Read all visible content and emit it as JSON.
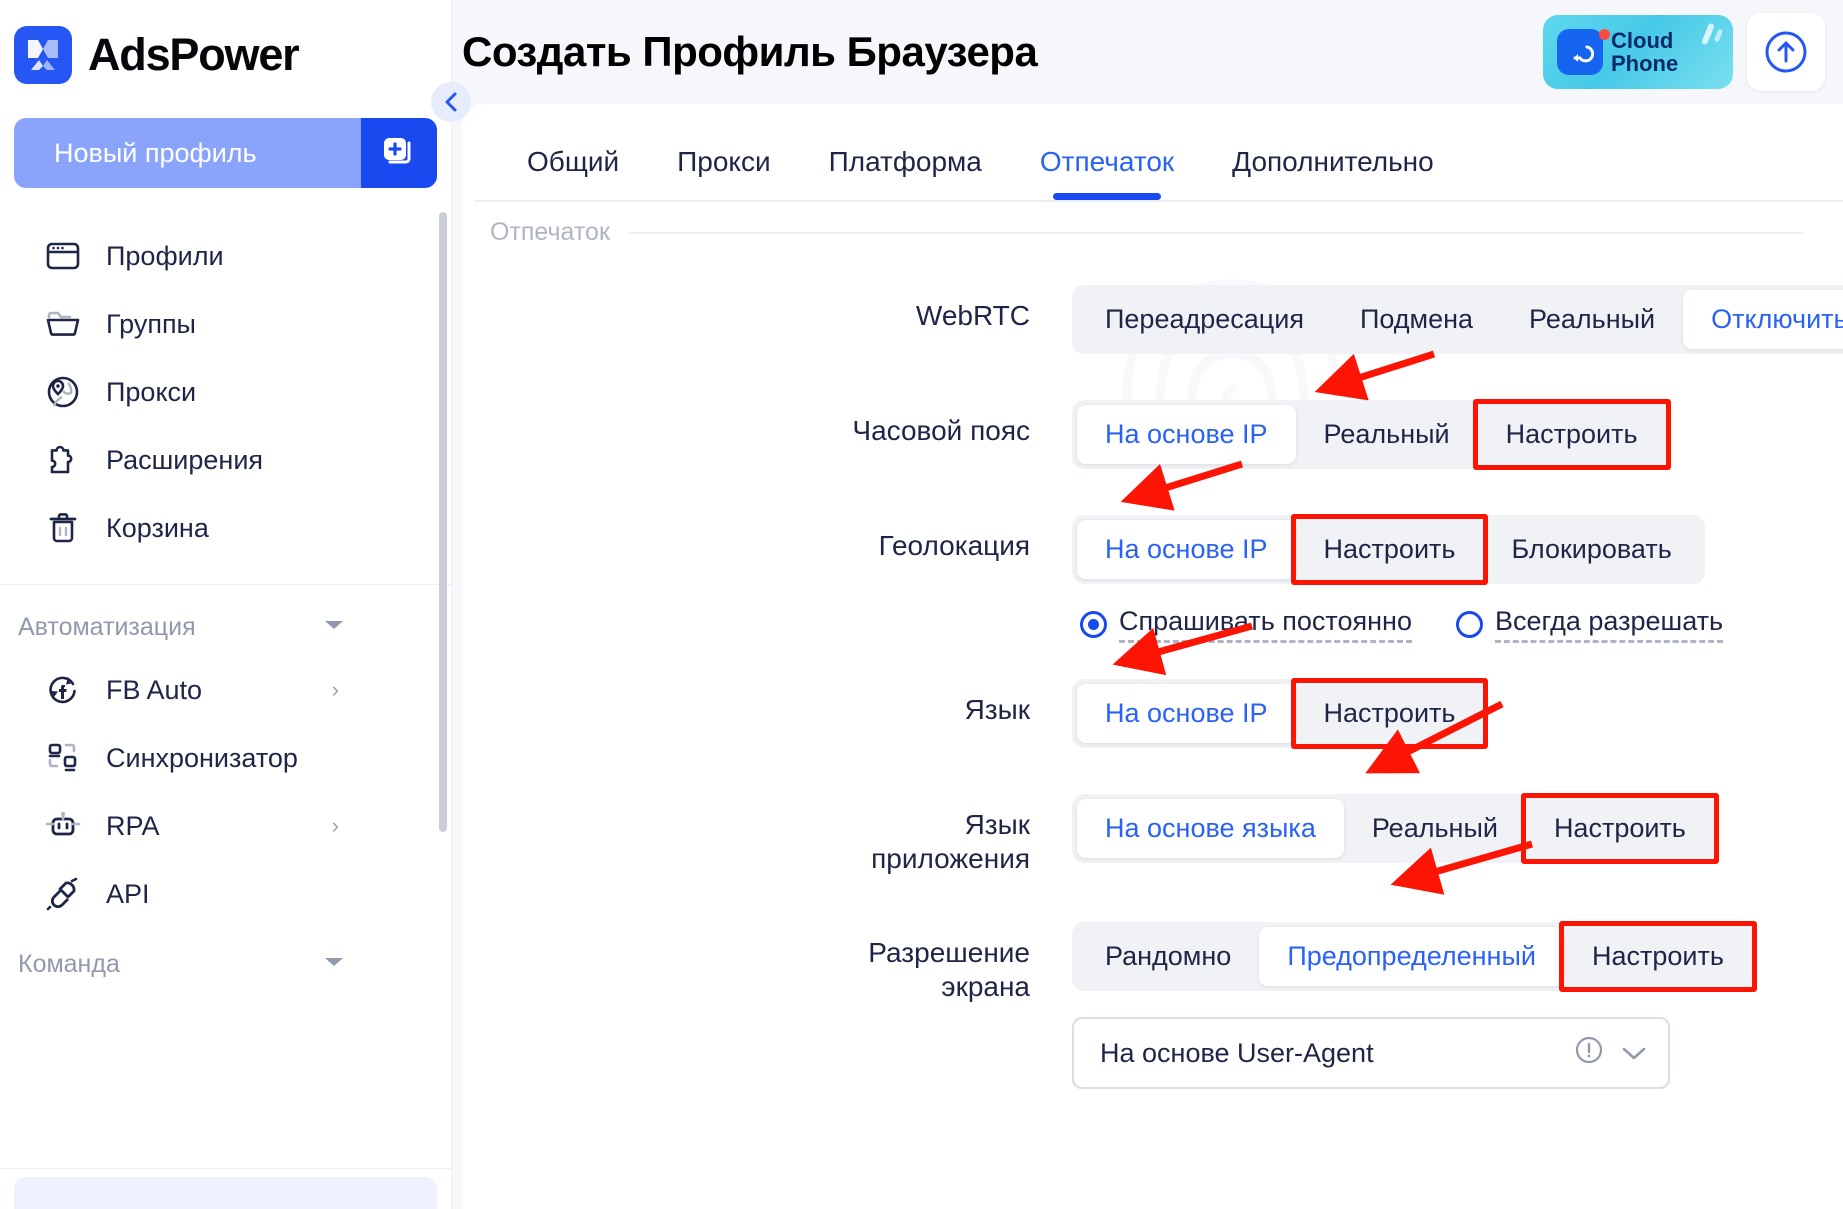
{
  "brand": {
    "name": "AdsPower",
    "logo_icon": "adspower-logo-icon"
  },
  "sidebar": {
    "new_profile_label": "Новый профиль",
    "new_profile_icon": "add-profile-icon",
    "collapse_icon": "chevron-left-icon",
    "items": [
      {
        "label": "Профили",
        "icon": "browser-window-icon",
        "chevron": ""
      },
      {
        "label": "Группы",
        "icon": "folder-icon",
        "chevron": ""
      },
      {
        "label": "Прокси",
        "icon": "globe-pin-icon",
        "chevron": ""
      },
      {
        "label": "Расширения",
        "icon": "puzzle-icon",
        "chevron": ""
      },
      {
        "label": "Корзина",
        "icon": "trash-icon",
        "chevron": ""
      }
    ],
    "groups": [
      {
        "title": "Автоматизация",
        "arrow_icon": "caret-down-icon",
        "items": [
          {
            "label": "FB Auto",
            "icon": "facebook-refresh-icon",
            "chevron": "›"
          },
          {
            "label": "Синхронизатор",
            "icon": "sync-nodes-icon",
            "chevron": ""
          },
          {
            "label": "RPA",
            "icon": "robot-icon",
            "chevron": "›"
          },
          {
            "label": "API",
            "icon": "plug-icon",
            "chevron": ""
          }
        ]
      },
      {
        "title": "Команда",
        "arrow_icon": "caret-down-icon",
        "items": []
      }
    ]
  },
  "header": {
    "title": "Создать Профиль Браузера",
    "cloud_phone": {
      "line1": "Cloud",
      "line2": "Phone",
      "icon": "cloud-phone-icon",
      "badge": "notification-dot"
    },
    "upload_button_icon": "upload-cloud-icon"
  },
  "tabs": [
    {
      "label": "Общий",
      "active": false
    },
    {
      "label": "Прокси",
      "active": false
    },
    {
      "label": "Платформа",
      "active": false
    },
    {
      "label": "Отпечаток",
      "active": true
    },
    {
      "label": "Дополнительно",
      "active": false
    }
  ],
  "section": {
    "label": "Отпечаток"
  },
  "form": {
    "rows": [
      {
        "key": "webrtc",
        "label": "WebRTC",
        "options": [
          {
            "label": "Переадресация",
            "selected": false,
            "highlighted": false
          },
          {
            "label": "Подмена",
            "selected": false,
            "highlighted": false
          },
          {
            "label": "Реальный",
            "selected": false,
            "highlighted": false
          },
          {
            "label": "Отключить",
            "selected": true,
            "highlighted": false
          }
        ]
      },
      {
        "key": "timezone",
        "label": "Часовой пояс",
        "options": [
          {
            "label": "На основе IP",
            "selected": true,
            "highlighted": false
          },
          {
            "label": "Реальный",
            "selected": false,
            "highlighted": false
          },
          {
            "label": "Настроить",
            "selected": false,
            "highlighted": true
          }
        ]
      },
      {
        "key": "geolocation",
        "label": "Геолокация",
        "options": [
          {
            "label": "На основе IP",
            "selected": true,
            "highlighted": false
          },
          {
            "label": "Настроить",
            "selected": false,
            "highlighted": true
          },
          {
            "label": "Блокировать",
            "selected": false,
            "highlighted": false
          }
        ],
        "radios": [
          {
            "label": "Спрашивать постоянно",
            "selected": true
          },
          {
            "label": "Всегда разрешать",
            "selected": false
          }
        ]
      },
      {
        "key": "language",
        "label": "Язык",
        "options": [
          {
            "label": "На основе IP",
            "selected": true,
            "highlighted": false
          },
          {
            "label": "Настроить",
            "selected": false,
            "highlighted": true
          }
        ]
      },
      {
        "key": "app-language",
        "label": "Язык\nприложения",
        "options": [
          {
            "label": "На основе языка",
            "selected": true,
            "highlighted": false
          },
          {
            "label": "Реальный",
            "selected": false,
            "highlighted": false
          },
          {
            "label": "Настроить",
            "selected": false,
            "highlighted": true
          }
        ]
      },
      {
        "key": "screen-resolution",
        "label": "Разрешение\nэкрана",
        "options": [
          {
            "label": "Рандомно",
            "selected": false,
            "highlighted": false
          },
          {
            "label": "Предопределенный",
            "selected": true,
            "highlighted": false
          },
          {
            "label": "Настроить",
            "selected": false,
            "highlighted": true
          }
        ],
        "select": {
          "value": "На основе User-Agent",
          "info_icon": "info-circle-icon",
          "chevron_icon": "chevron-down-icon"
        }
      }
    ]
  },
  "annotations": {
    "arrow_color": "#fc1505",
    "highlight_color": "#fc1505",
    "count": 5
  },
  "colors": {
    "accent": "#2a62f6",
    "brand_blue": "#1a49f0",
    "text": "#1e2547",
    "muted": "#9299ad",
    "seg_bg": "#f1f2f5"
  }
}
